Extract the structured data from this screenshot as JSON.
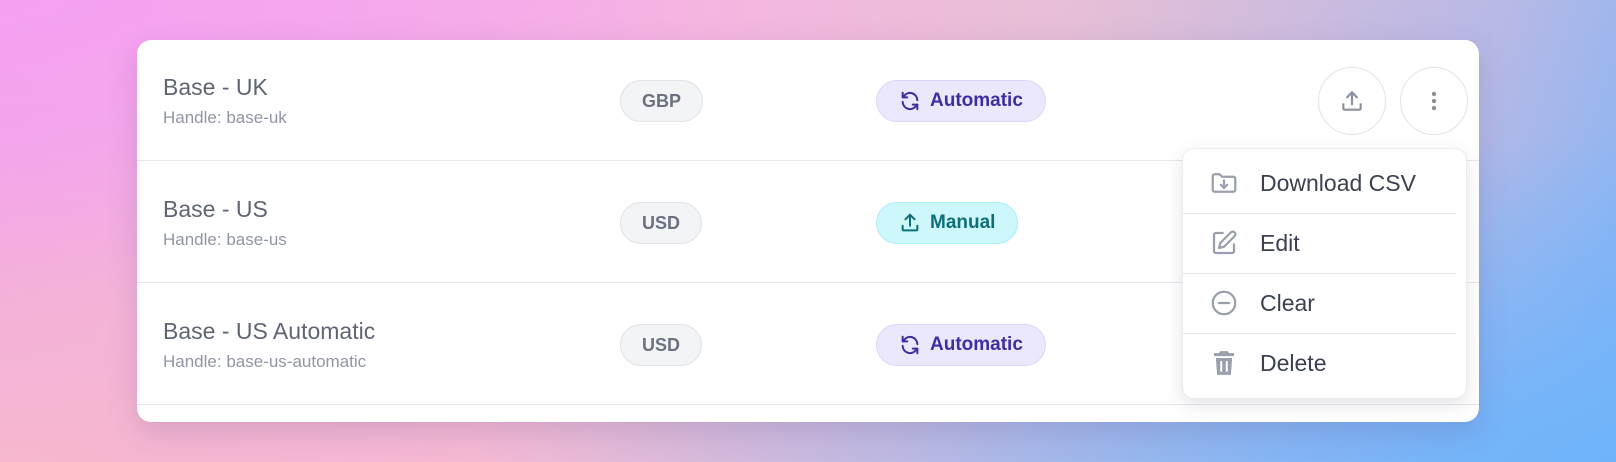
{
  "rows": [
    {
      "name": "Base - UK",
      "handle": "Handle: base-uk",
      "currency": "GBP",
      "mode": "Automatic",
      "mode_icon": "refresh-icon"
    },
    {
      "name": "Base - US",
      "handle": "Handle: base-us",
      "currency": "USD",
      "mode": "Manual",
      "mode_icon": "upload-icon"
    },
    {
      "name": "Base - US Automatic",
      "handle": "Handle: base-us-automatic",
      "currency": "USD",
      "mode": "Automatic",
      "mode_icon": "refresh-icon"
    }
  ],
  "menu": {
    "items": [
      {
        "label": "Download CSV",
        "icon": "folder-download-icon"
      },
      {
        "label": "Edit",
        "icon": "edit-icon"
      },
      {
        "label": "Clear",
        "icon": "minus-circle-icon"
      },
      {
        "label": "Delete",
        "icon": "trash-icon"
      }
    ]
  },
  "colors": {
    "automatic_bg": "#ece8fb",
    "automatic_text": "#3d2fa0",
    "manual_bg": "#cdf7fb",
    "manual_text": "#0e6f78"
  }
}
